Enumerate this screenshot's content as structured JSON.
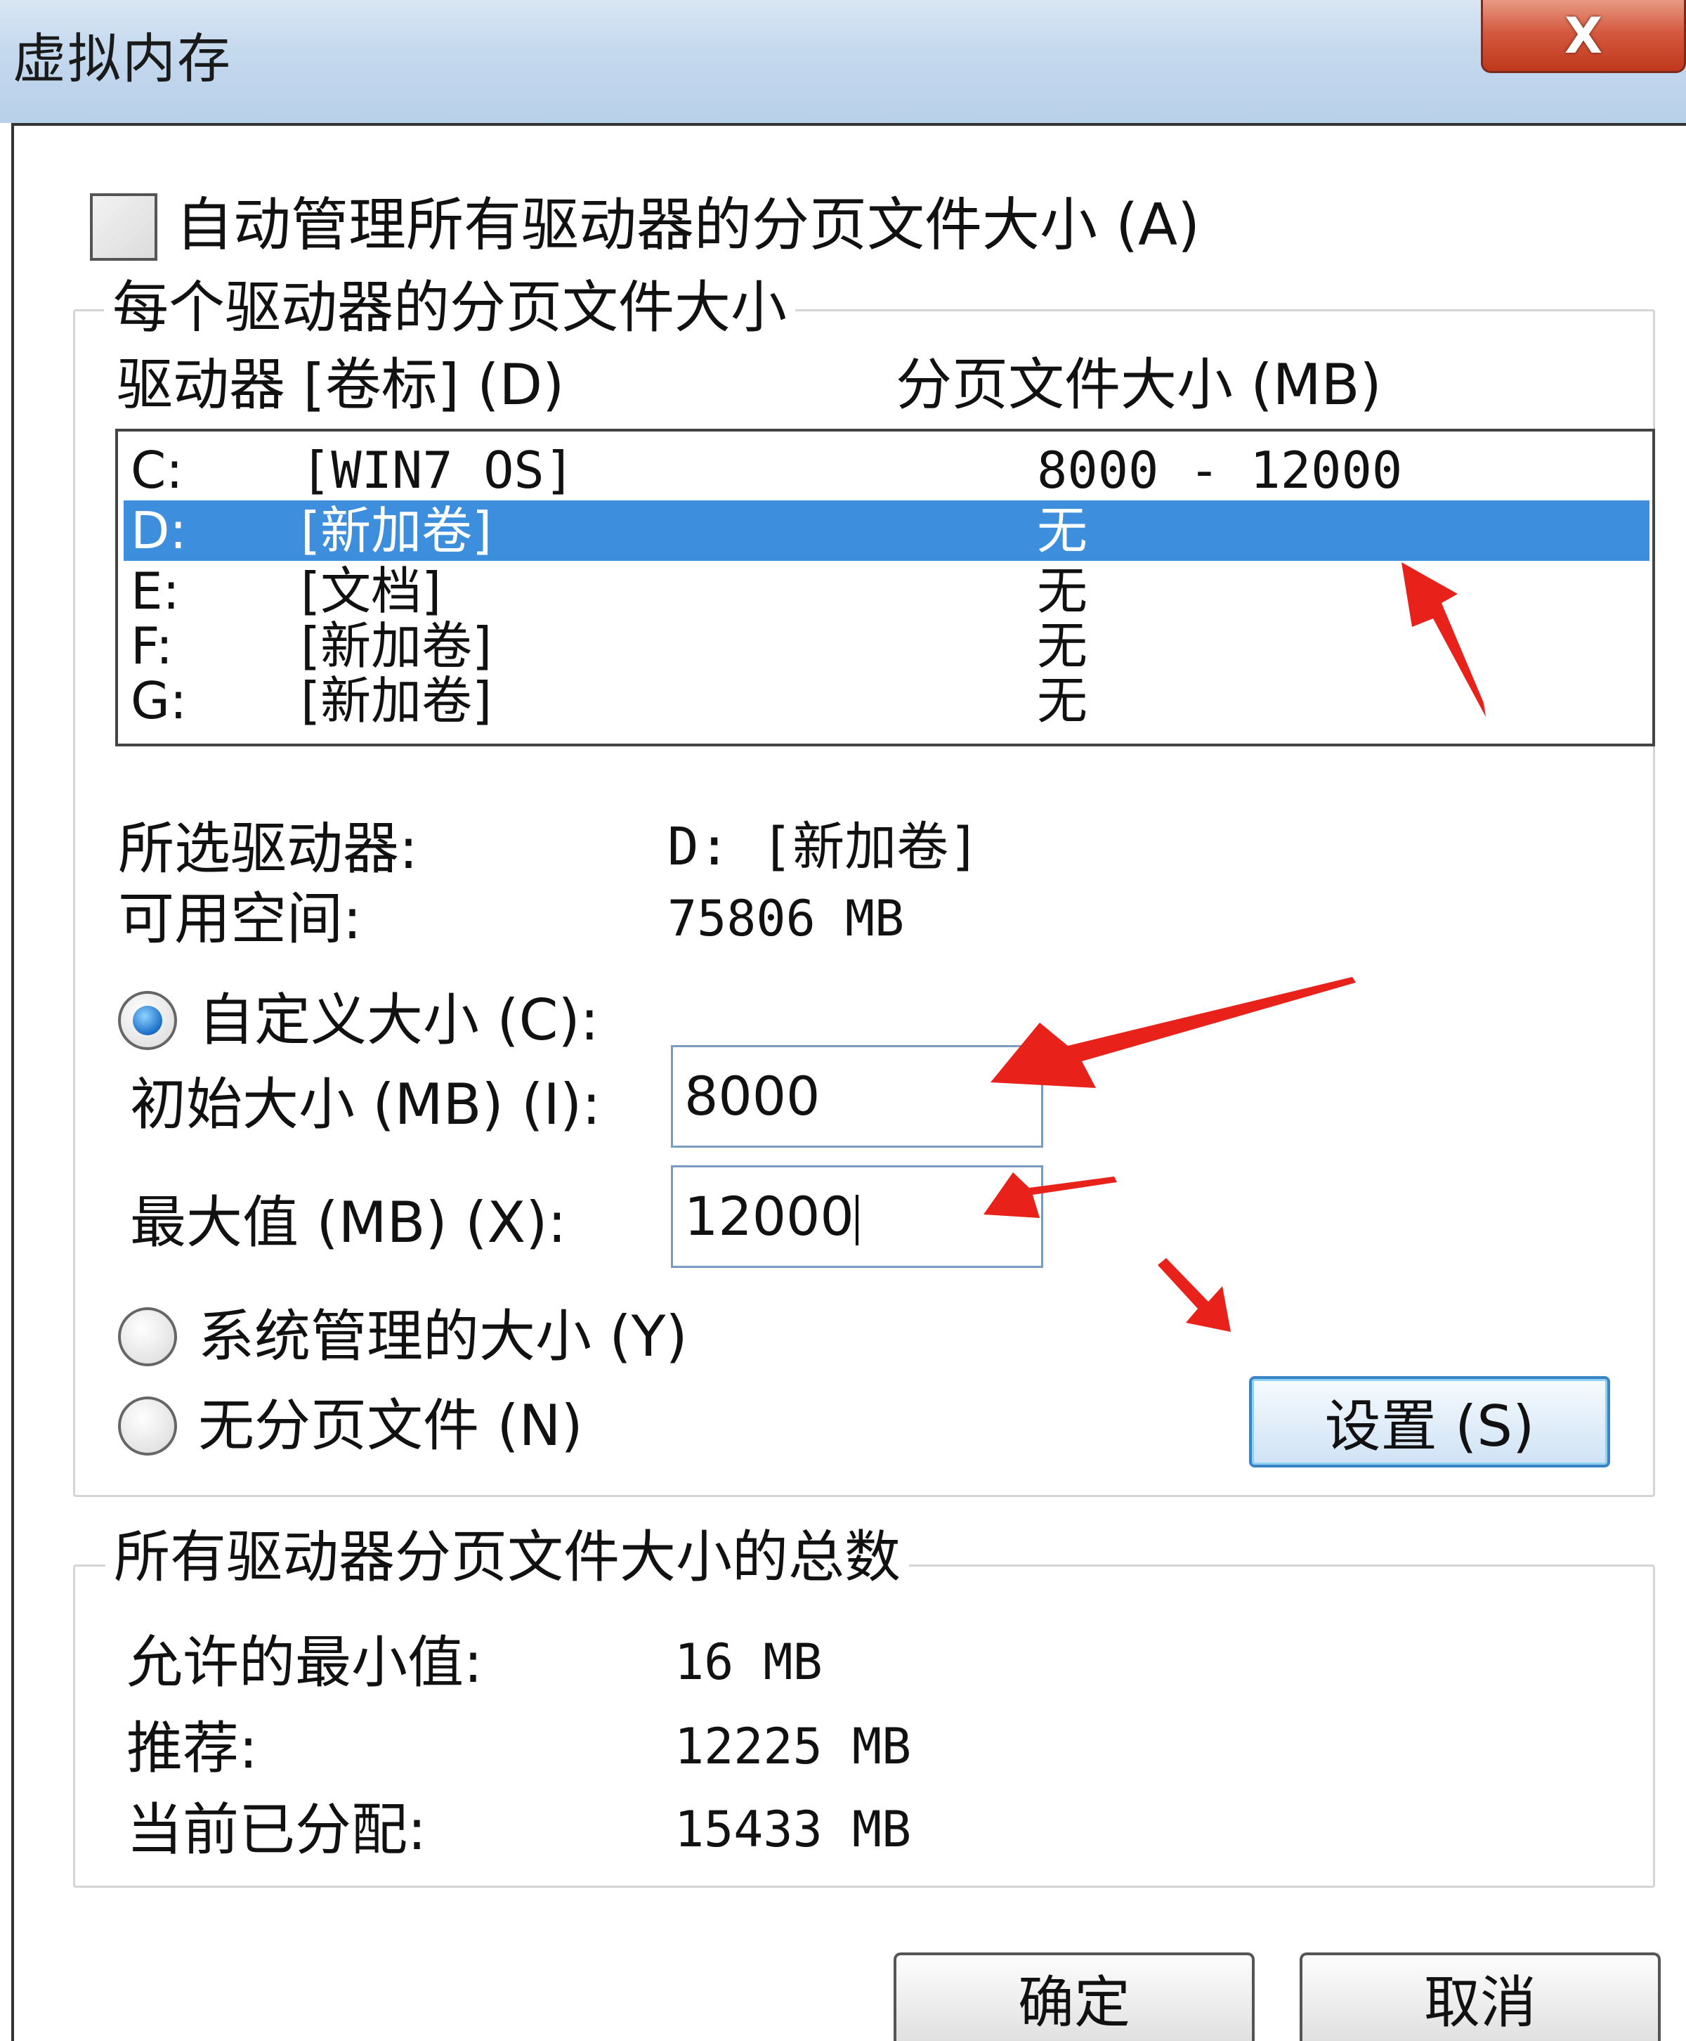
{
  "window": {
    "title": "虚拟内存",
    "close_glyph": "X"
  },
  "auto_manage": {
    "label": "自动管理所有驱动器的分页文件大小 (A)",
    "checked": false
  },
  "per_drive": {
    "group_label": "每个驱动器的分页文件大小",
    "col_drive": "驱动器 [卷标] (D)",
    "col_size": "分页文件大小 (MB)",
    "drives": [
      {
        "letter": "C:",
        "label": "[WIN7 OS]",
        "size": "8000 - 12000",
        "selected": false
      },
      {
        "letter": "D:",
        "label": "[新加卷]",
        "size": "无",
        "selected": true
      },
      {
        "letter": "E:",
        "label": "[文档]",
        "size": "无",
        "selected": false
      },
      {
        "letter": "F:",
        "label": "[新加卷]",
        "size": "无",
        "selected": false
      },
      {
        "letter": "G:",
        "label": "[新加卷]",
        "size": "无",
        "selected": false
      }
    ],
    "selected_drive_label": "所选驱动器:",
    "selected_drive_value": "D:   [新加卷]",
    "free_space_label": "可用空间:",
    "free_space_value": "75806 MB",
    "custom_size_label": "自定义大小 (C):",
    "initial_size_label": "初始大小 (MB) (I):",
    "initial_size_value": "8000",
    "max_size_label": "最大值 (MB) (X):",
    "max_size_value": "12000",
    "system_managed_label": "系统管理的大小 (Y)",
    "no_paging_label": "无分页文件 (N)",
    "set_button": "设置 (S)",
    "selected_option": "custom"
  },
  "totals": {
    "group_label": "所有驱动器分页文件大小的总数",
    "min_label": "允许的最小值:",
    "min_value": "16 MB",
    "recommended_label": "推荐:",
    "recommended_value": "12225 MB",
    "allocated_label": "当前已分配:",
    "allocated_value": "15433 MB"
  },
  "footer": {
    "ok_button": "确定",
    "cancel_button": "取消"
  },
  "colors": {
    "selection": "#3e8ede",
    "annotation_arrow": "#e8211a",
    "close_button": "#c9462b"
  }
}
